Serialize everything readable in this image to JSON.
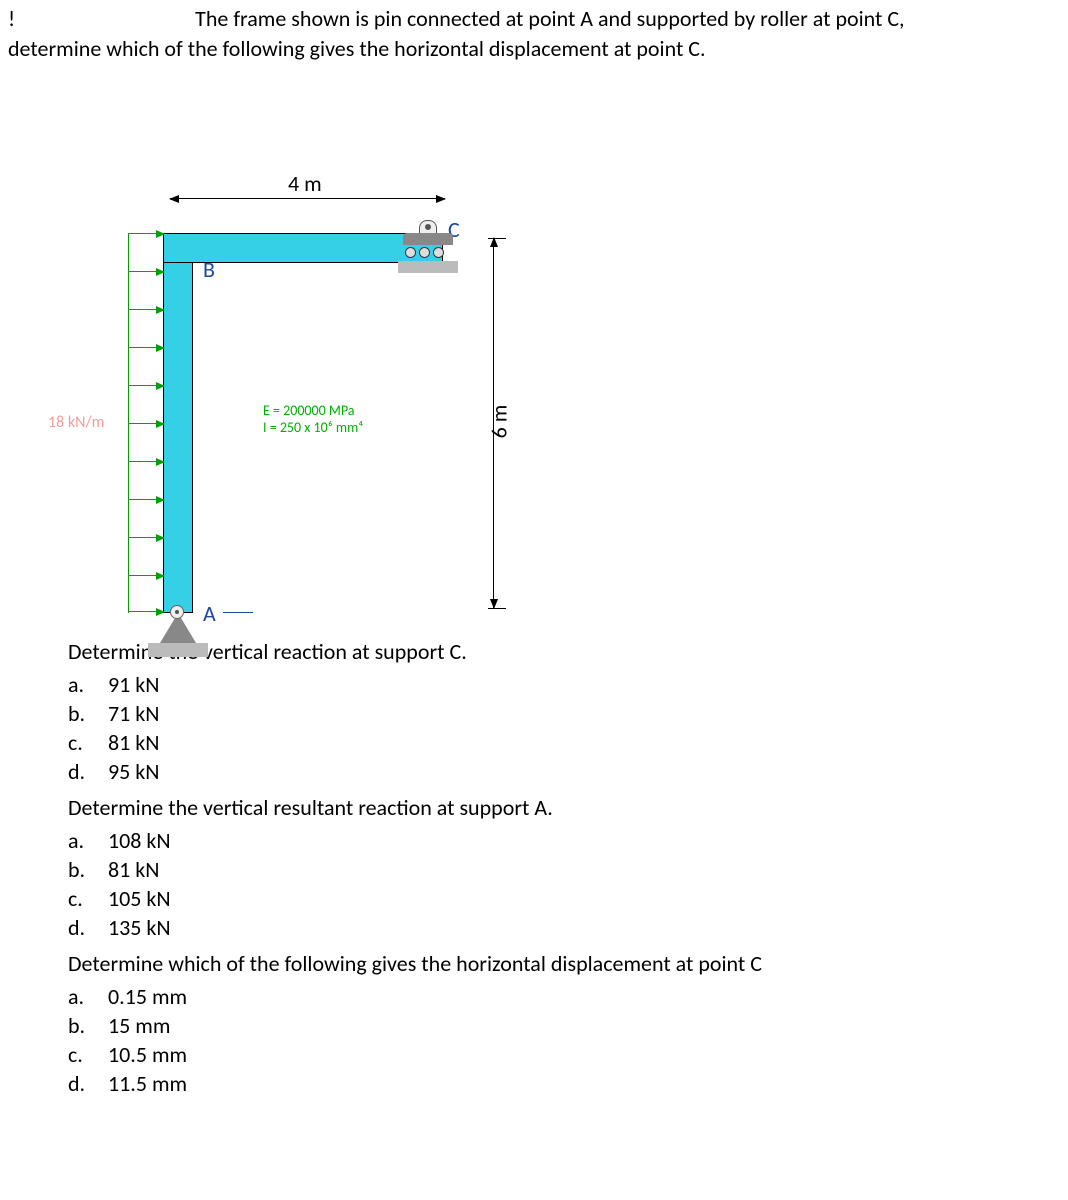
{
  "problem": {
    "line1_prefix": "!",
    "line1_main": "The frame shown is pin connected at point A and supported by roller at point C,",
    "line2": "determine which of the following gives the horizontal displacement at point C."
  },
  "figure": {
    "top_dim": "4 m",
    "right_dim": "6 m",
    "point_A": "A",
    "point_B": "B",
    "point_C": "C",
    "load_label": "18 kN/m",
    "E_line": "E = 200000 MPa",
    "I_line": "I = 250 x 10⁶ mm⁴"
  },
  "questions": [
    {
      "prompt": "Determine the vertical reaction at support C.",
      "options": [
        {
          "letter": "a.",
          "value": "91 kN"
        },
        {
          "letter": "b.",
          "value": "71 kN"
        },
        {
          "letter": "c.",
          "value": "81 kN"
        },
        {
          "letter": "d.",
          "value": "95 kN"
        }
      ]
    },
    {
      "prompt": "Determine the vertical resultant reaction at support A.",
      "options": [
        {
          "letter": "a.",
          "value": "108 kN"
        },
        {
          "letter": "b.",
          "value": "81 kN"
        },
        {
          "letter": "c.",
          "value": "105 kN"
        },
        {
          "letter": "d.",
          "value": "135 kN"
        }
      ]
    },
    {
      "prompt": "Determine which of the following gives the horizontal displacement at point C",
      "options": [
        {
          "letter": "a.",
          "value": "0.15 mm"
        },
        {
          "letter": "b.",
          "value": "15 mm"
        },
        {
          "letter": "c.",
          "value": "10.5 mm"
        },
        {
          "letter": "d.",
          "value": "11.5 mm"
        }
      ]
    }
  ]
}
